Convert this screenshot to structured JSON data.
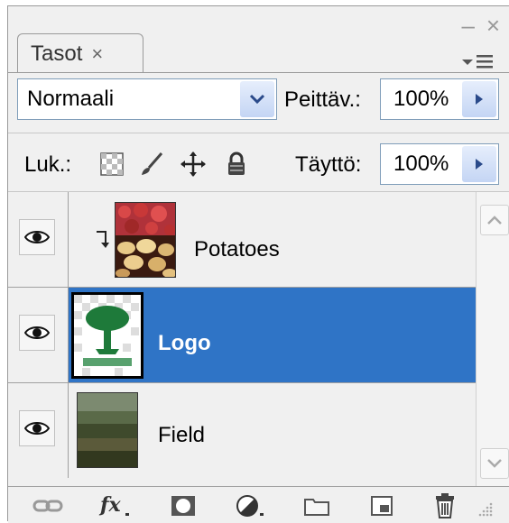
{
  "panel": {
    "tab_label": "Tasot",
    "tab_close": "×",
    "window_minimize": "–",
    "window_close": "×"
  },
  "blend": {
    "mode": "Normaali"
  },
  "opacity": {
    "label": "Peittäv.:",
    "value": "100%"
  },
  "locks": {
    "label": "Luk.:",
    "icons": [
      "lock-transparent-icon",
      "lock-pixels-brush-icon",
      "lock-position-move-icon",
      "lock-all-padlock-icon"
    ]
  },
  "fill": {
    "label": "Täyttö:",
    "value": "100%"
  },
  "layers": [
    {
      "name": "Potatoes",
      "visible": true,
      "clipped": true,
      "selected": false
    },
    {
      "name": "Logo",
      "visible": true,
      "clipped": false,
      "selected": true
    },
    {
      "name": "Field",
      "visible": true,
      "clipped": false,
      "selected": false
    }
  ],
  "footer_tools": [
    "link-layers-icon",
    "fx-icon",
    "layer-mask-icon",
    "adjustment-layer-icon",
    "new-group-folder-icon",
    "new-layer-icon",
    "trash-icon"
  ],
  "colors": {
    "selection": "#2f74c6",
    "panel_bg": "#f0f0f0"
  }
}
